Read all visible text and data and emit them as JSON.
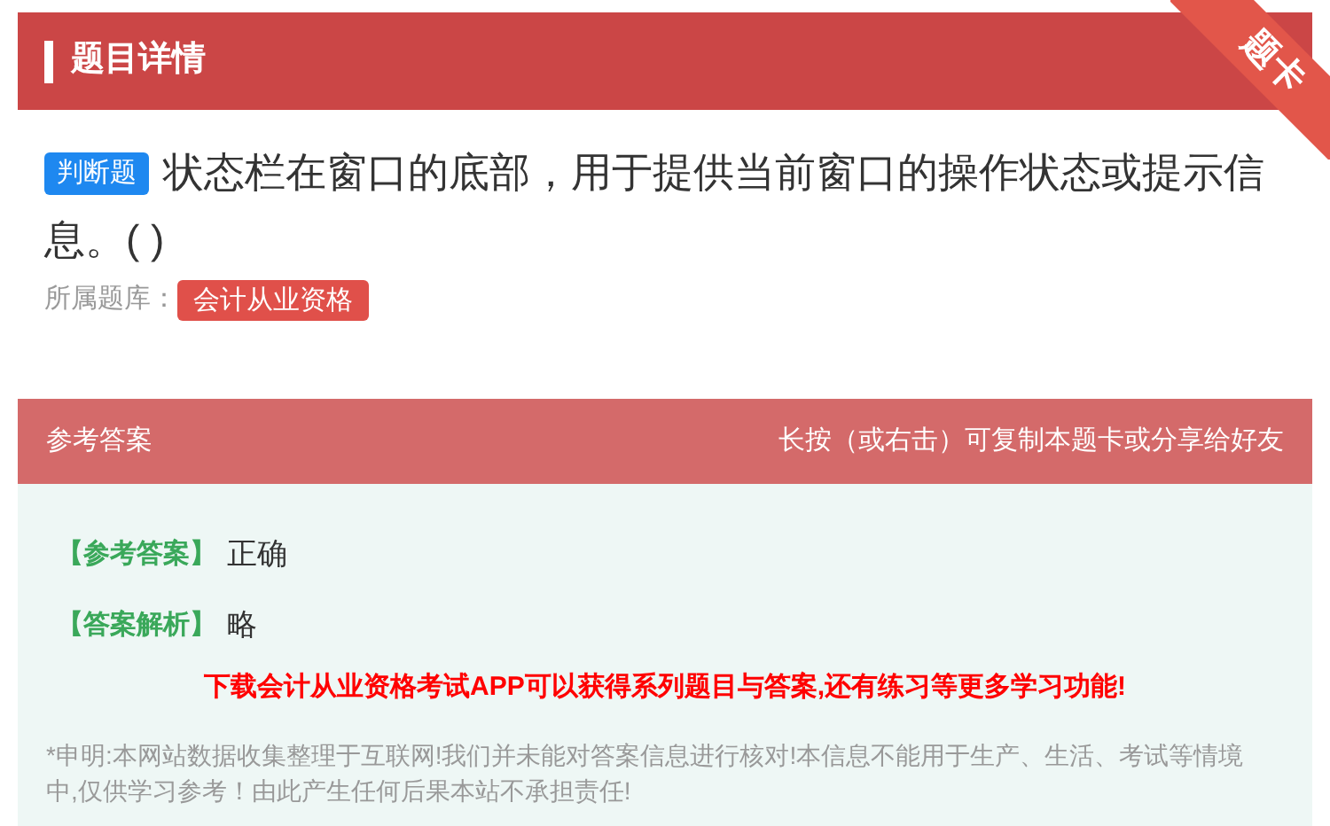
{
  "header": {
    "title": "题目详情",
    "ribbon": "题卡"
  },
  "question": {
    "type_badge": "判断题",
    "text": "状态栏在窗口的底部，用于提供当前窗口的操作状态或提示信息。( )",
    "bank_label": "所属题库：",
    "bank_tag": "会计从业资格"
  },
  "answer_section": {
    "title": "参考答案",
    "hint": "长按（或右击）可复制本题卡或分享给好友",
    "rows": [
      {
        "label": "【参考答案】",
        "value": "正确"
      },
      {
        "label": "【答案解析】",
        "value": "略"
      }
    ],
    "promo": "下载会计从业资格考试APP可以获得系列题目与答案,还有练习等更多学习功能!",
    "disclaimer": "*申明:本网站数据收集整理于互联网!我们并未能对答案信息进行核对!本信息不能用于生产、生活、考试等情境中,仅供学习参考！由此产生任何后果本站不承担责任!"
  }
}
